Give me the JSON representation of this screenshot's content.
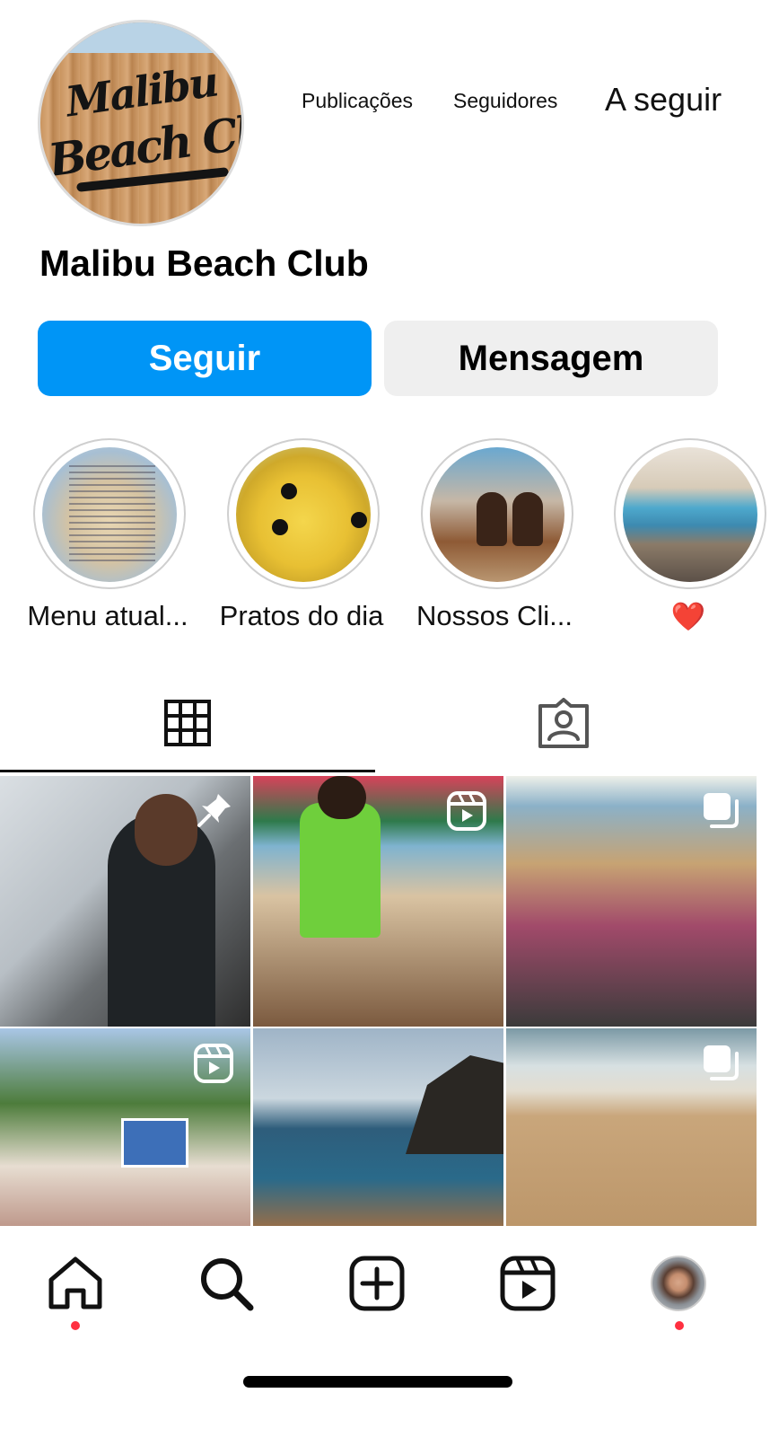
{
  "profile": {
    "name": "Malibu Beach Club",
    "avatar_logo_line1": "Malibu",
    "avatar_logo_line2": "Beach Club"
  },
  "stats": {
    "posts_label": "Publicações",
    "followers_label": "Seguidores",
    "following_label": "A seguir"
  },
  "actions": {
    "follow_label": "Seguir",
    "message_label": "Mensagem"
  },
  "highlights": [
    {
      "label": "Menu atual..."
    },
    {
      "label": "Pratos do dia"
    },
    {
      "label": "Nossos Cli..."
    },
    {
      "label": "❤️"
    }
  ],
  "tabs": [
    {
      "icon": "grid-icon",
      "active": true
    },
    {
      "icon": "tagged-icon",
      "active": false
    }
  ],
  "posts": [
    {
      "badge": "pin-icon"
    },
    {
      "badge": "reel-icon"
    },
    {
      "badge": "carousel-icon"
    },
    {
      "badge": "reel-icon"
    },
    {
      "badge": ""
    },
    {
      "badge": "carousel-icon"
    }
  ],
  "bottom_nav": [
    "home-icon",
    "search-icon",
    "create-icon",
    "reels-icon",
    "profile-avatar"
  ],
  "colors": {
    "follow_button": "#0095f6",
    "message_button": "#efefef",
    "notification_dot": "#ff3040"
  }
}
